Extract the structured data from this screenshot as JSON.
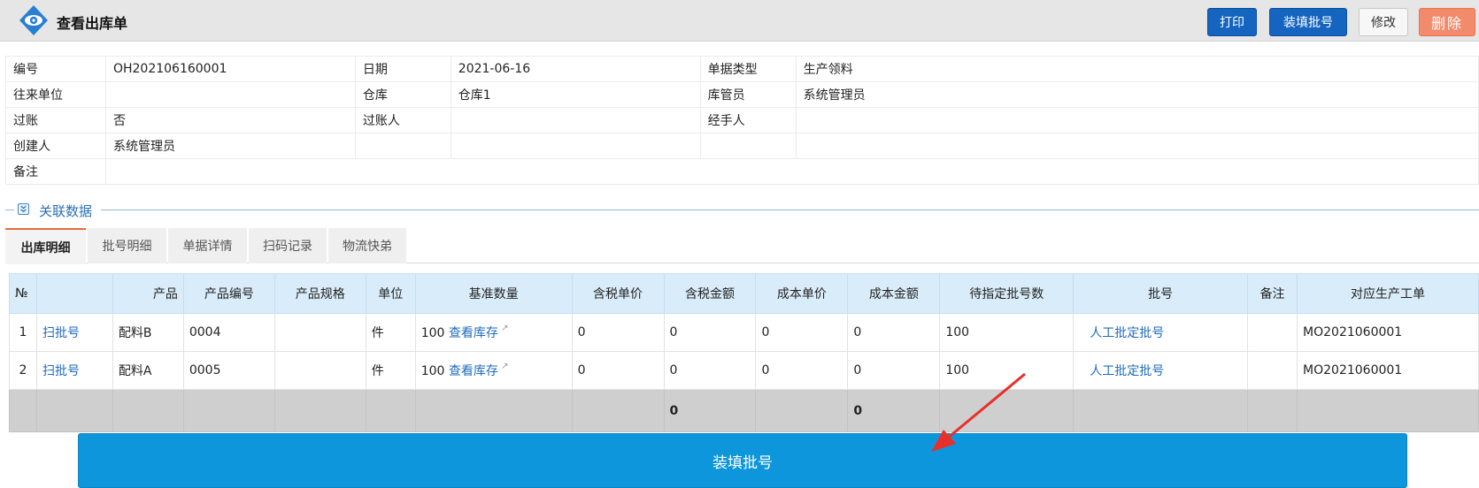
{
  "header": {
    "title": "查看出库单",
    "buttons": {
      "print": "打印",
      "fill_batch": "装填批号",
      "edit": "修改",
      "delete": "删除"
    }
  },
  "info": {
    "rows": [
      [
        {
          "label": "编号",
          "value": "OH202106160001"
        },
        {
          "label": "日期",
          "value": "2021-06-16"
        },
        {
          "label": "单据类型",
          "value": "生产领料"
        }
      ],
      [
        {
          "label": "往来单位",
          "value": ""
        },
        {
          "label": "仓库",
          "value": "仓库1"
        },
        {
          "label": "库管员",
          "value": "系统管理员"
        }
      ],
      [
        {
          "label": "过账",
          "value": "否"
        },
        {
          "label": "过账人",
          "value": ""
        },
        {
          "label": "经手人",
          "value": ""
        }
      ],
      [
        {
          "label": "创建人",
          "value": "系统管理员"
        },
        {
          "label": "",
          "value": ""
        },
        {
          "label": "",
          "value": ""
        }
      ]
    ],
    "remark_label": "备注",
    "remark_value": ""
  },
  "section": {
    "title": "关联数据"
  },
  "tabs": [
    "出库明细",
    "批号明细",
    "单据详情",
    "扫码记录",
    "物流快弟"
  ],
  "grid": {
    "headers": [
      "№",
      "",
      "产品",
      "产品编号",
      "产品规格",
      "单位",
      "基准数量",
      "含税单价",
      "含税金额",
      "成本单价",
      "成本金额",
      "待指定批号数",
      "批号",
      "备注",
      "对应生产工单"
    ],
    "rows": [
      {
        "no": "1",
        "scan": "扫批号",
        "product": "配料B",
        "code": "0004",
        "spec": "",
        "unit": "件",
        "qty": "100",
        "stock_link": "查看库存",
        "tax_price": "0",
        "tax_amount": "0",
        "cost_price": "0",
        "cost_amount": "0",
        "pending": "100",
        "batch_link": "人工批定批号",
        "remark": "",
        "work_order": "MO2021060001"
      },
      {
        "no": "2",
        "scan": "扫批号",
        "product": "配料A",
        "code": "0005",
        "spec": "",
        "unit": "件",
        "qty": "100",
        "stock_link": "查看库存",
        "tax_price": "0",
        "tax_amount": "0",
        "cost_price": "0",
        "cost_amount": "0",
        "pending": "100",
        "batch_link": "人工批定批号",
        "remark": "",
        "work_order": "MO2021060001"
      }
    ],
    "summary": {
      "tax_amount": "0",
      "cost_amount": "0"
    }
  },
  "action": {
    "fill_batch": "装填批号"
  },
  "colors": {
    "primary": "#1565c0",
    "action": "#0d96db",
    "danger": "#f28b6c",
    "link": "#1f6bbf",
    "accent": "#e36b3e",
    "arrow": "#e8302a"
  }
}
